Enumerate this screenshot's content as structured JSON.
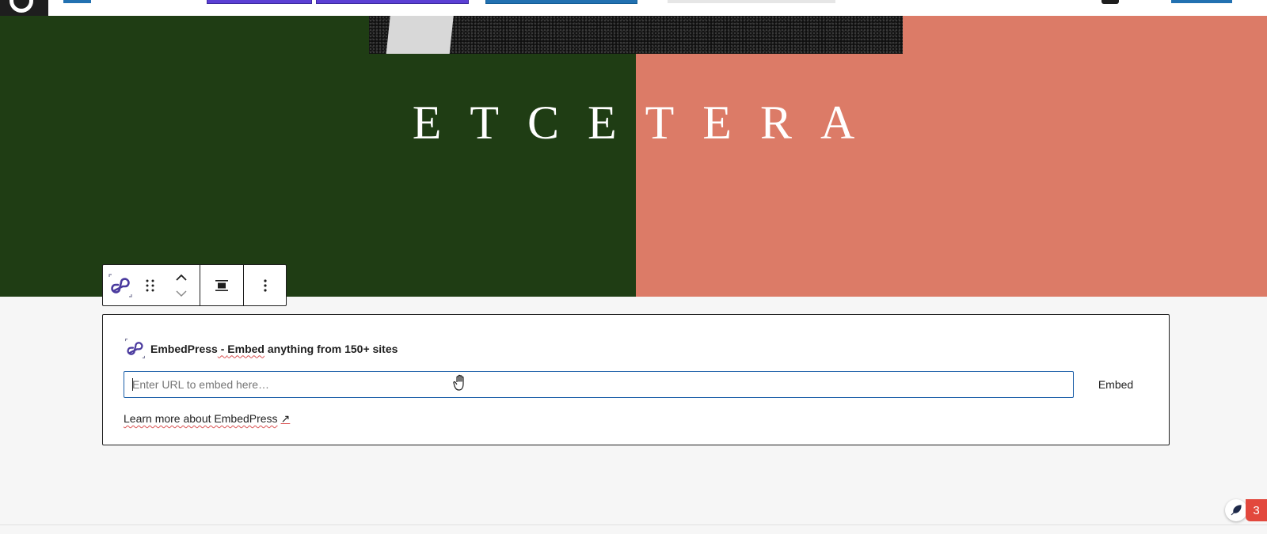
{
  "hero": {
    "title": "ETCETERA",
    "colors": {
      "left": "#1f3d14",
      "right": "#dc7b67"
    }
  },
  "toolbar": {
    "block_icon": "embedpress-logo-icon",
    "drag_icon": "drag-handle-icon",
    "move_up_icon": "chevron-up-icon",
    "move_down_icon": "chevron-down-icon",
    "align_icon": "align-center-icon",
    "options_icon": "more-vertical-icon"
  },
  "embed": {
    "title_brand": "EmbedPress",
    "title_sep": " - ",
    "title_embed": "Embed",
    "title_rest": " anything from 150+ sites",
    "input_placeholder": "Enter URL to embed here…",
    "input_value": "",
    "button_label": "Embed",
    "learn_more": "Learn more about EmbedPress",
    "learn_more_arrow": "↗"
  },
  "notifications": {
    "count": "3",
    "icon": "grammarly-feather-icon"
  },
  "accent_colors": {
    "wp_blue": "#2271b1",
    "purple": "#5b3fd4",
    "error_red": "#e2483d"
  }
}
